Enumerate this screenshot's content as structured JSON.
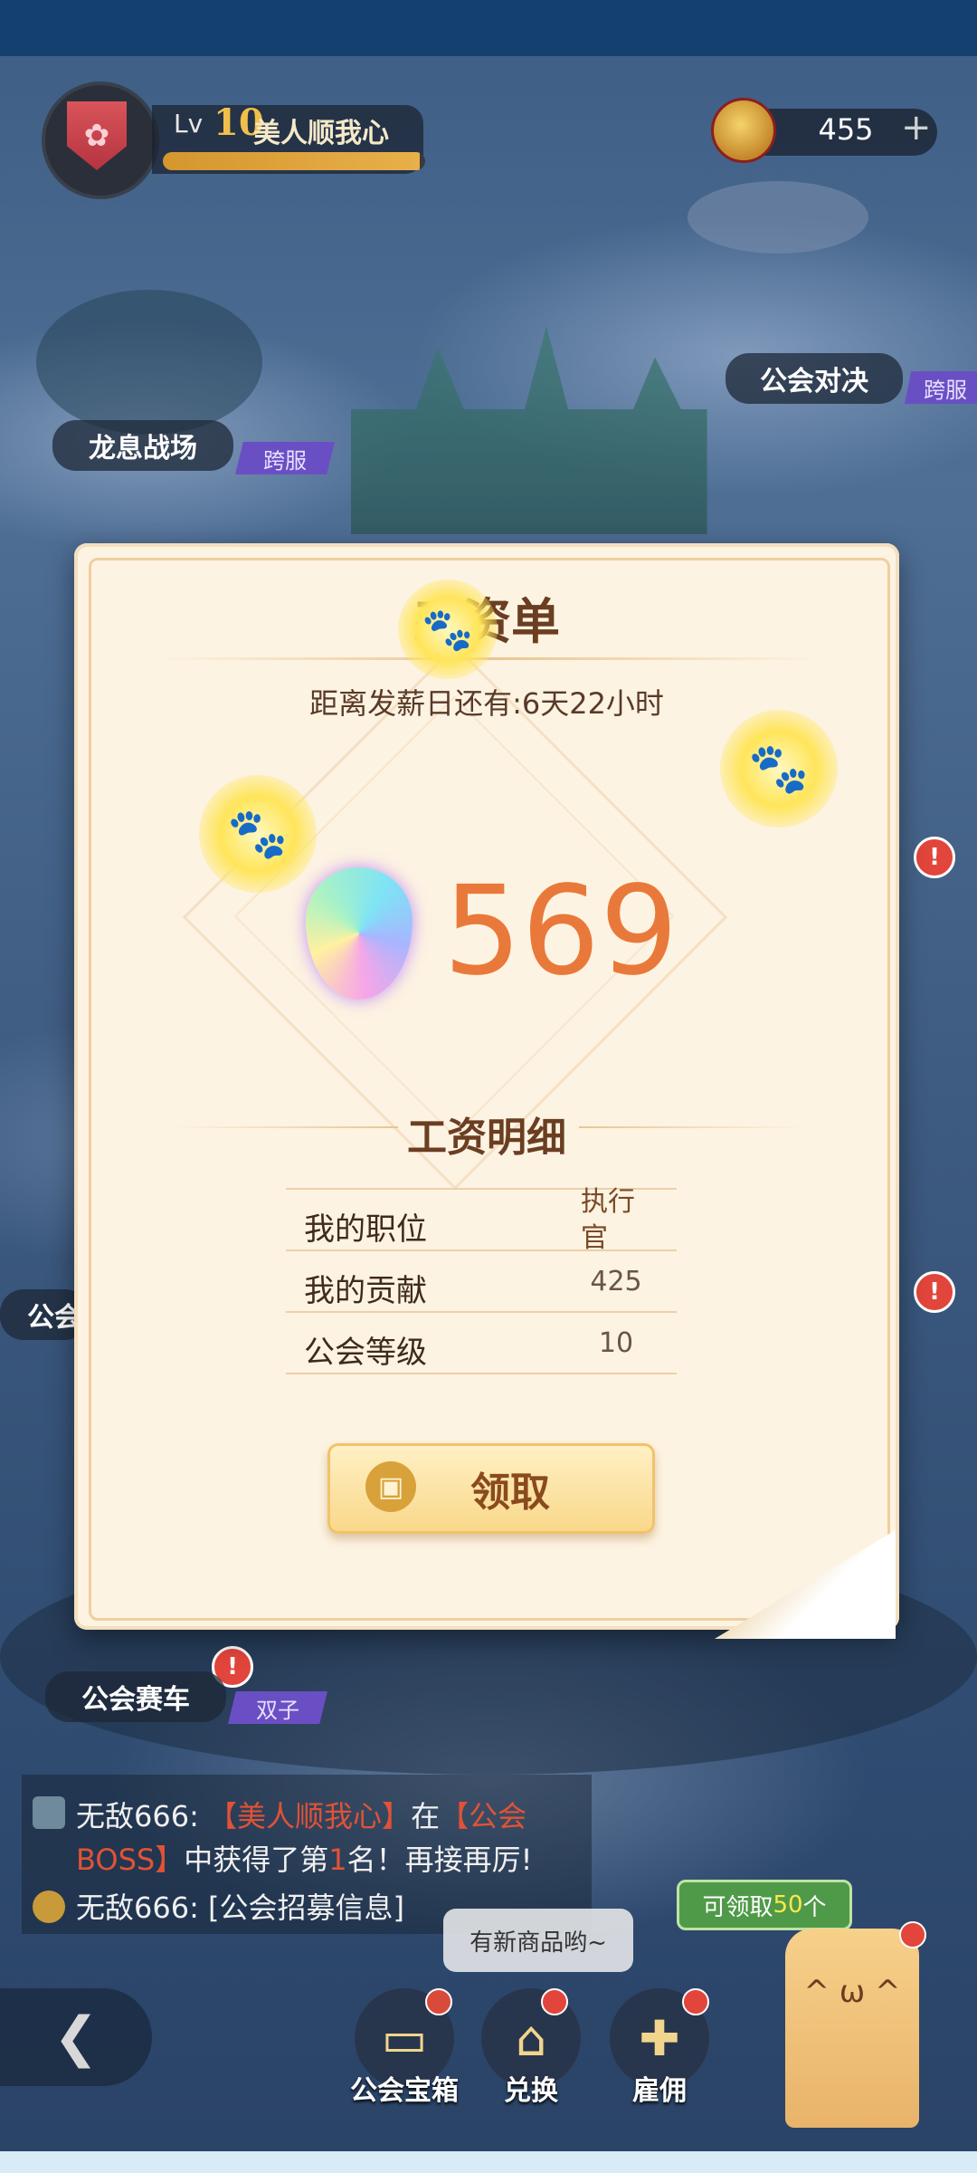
{
  "player": {
    "level_prefix": "Lv",
    "level": "10",
    "name": "美人顺我心",
    "exp_progress": 0.98
  },
  "currency": {
    "amount": "455",
    "add_label": "+"
  },
  "map": {
    "locations": [
      {
        "label": "龙息战场",
        "tag": "跨服"
      },
      {
        "label": "公会对决",
        "tag": "跨服"
      },
      {
        "label": "公会赛车",
        "tag": "双子"
      },
      {
        "label": "公会"
      }
    ],
    "alert_mark": "!"
  },
  "payslip": {
    "title": "工资单",
    "countdown": "距离发薪日还有:6天22小时",
    "amount": "569",
    "detail_title": "工资明细",
    "rows": [
      {
        "key": "我的职位",
        "value": "执行官"
      },
      {
        "key": "我的贡献",
        "value": "425"
      },
      {
        "key": "公会等级",
        "value": "10"
      }
    ],
    "claim_label": "领取"
  },
  "chat": {
    "line1_sender": "无敌666: ",
    "line1_highlight1": "【美人顺我心】",
    "line1_text1": "在",
    "line1_highlight2": "【公会BOSS】",
    "line1_text2": "中获得了第",
    "line1_rank": "1",
    "line1_text3": "名！再接再厉!",
    "line2_sender": "无敌666: ",
    "line2_text": "[公会招募信息]"
  },
  "shop_bubble": "有新商品哟~",
  "claimable": {
    "prefix": "可领取",
    "count": "50",
    "suffix": "个"
  },
  "dock": [
    {
      "label": "公会宝箱"
    },
    {
      "label": "兑换"
    },
    {
      "label": "雇佣"
    }
  ],
  "icons": {
    "back": "chevron-left-icon",
    "gift": "gift-icon",
    "gem": "rainbow-gem-icon",
    "paw": "paw-icon",
    "coin": "medal-coin-icon"
  },
  "colors": {
    "amount": "#e9793a",
    "title": "#6b3e22",
    "highlight": "#e15236"
  }
}
